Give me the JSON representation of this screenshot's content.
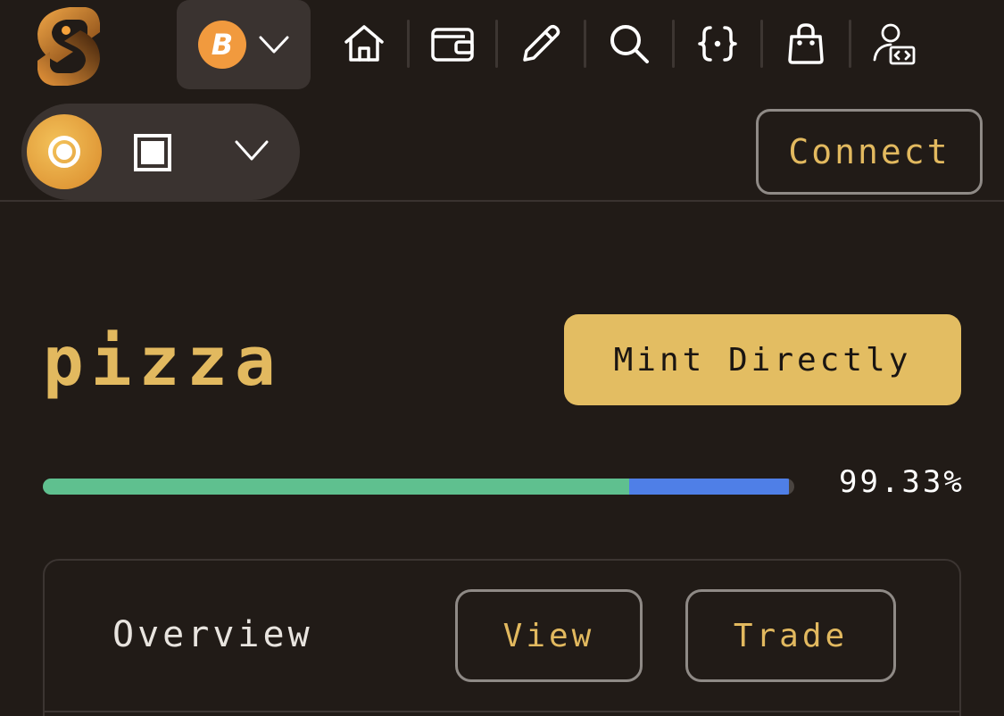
{
  "nav": {
    "chain_symbol": "B",
    "icons": [
      "home-icon",
      "wallet-icon",
      "pencil-icon",
      "search-icon",
      "code-braces-icon",
      "shopping-bag-icon",
      "developer-icon"
    ]
  },
  "header": {
    "connect_label": "Connect"
  },
  "token": {
    "name": "pizza",
    "mint_label": "Mint Directly",
    "progress_percent": "99.33%",
    "progress_green_fraction": 0.78,
    "progress_blue_fraction": 0.2133
  },
  "tabs": {
    "overview": "Overview",
    "view": "View",
    "trade": "Trade"
  },
  "colors": {
    "accent": "#e2b95f",
    "background": "#211b17",
    "bitcoin": "#f19a3e",
    "progress_green": "#5fc08f",
    "progress_blue": "#4f7fe7"
  }
}
